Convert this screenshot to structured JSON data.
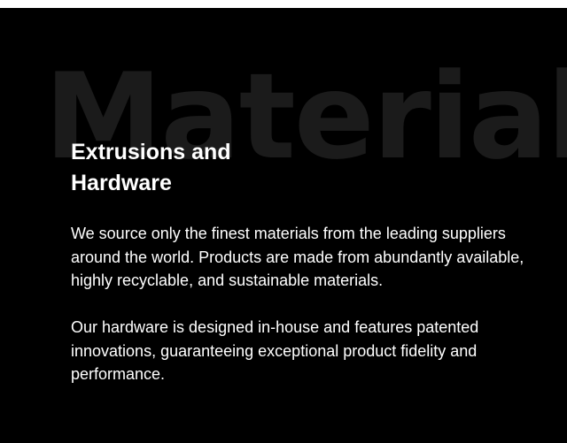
{
  "background_word": "Materials",
  "heading": {
    "line1": "Extrusions and",
    "line2": "Hardware"
  },
  "paragraphs": [
    "We source only the finest materials from the leading suppliers around the world. Products are made from abundantly available, highly recyclable, and sustainable materials.",
    "Our hardware is designed in-house and features patented innovations, guaranteeing exceptional product fidelity and performance."
  ],
  "colors": {
    "background": "#000000",
    "text": "#ffffff",
    "background_word": "#1b1b1b"
  }
}
